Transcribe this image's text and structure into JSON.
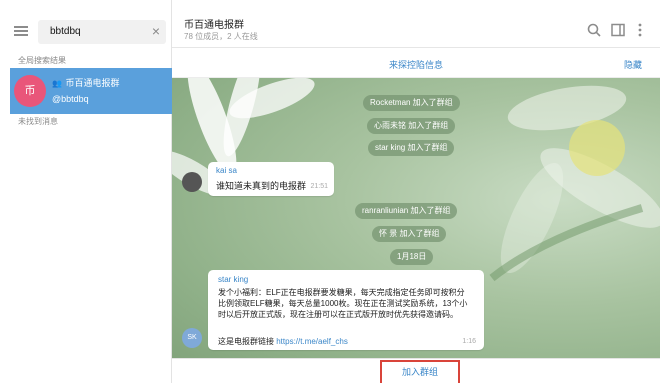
{
  "search": {
    "value": "bbtdbq"
  },
  "sidebar": {
    "global_results_label": "全局搜索结果",
    "result": {
      "avatar_text": "币",
      "title": "币百通电报群",
      "username": "@bbtdbq"
    },
    "no_messages_label": "未找到消息"
  },
  "header": {
    "title": "币百通电报群",
    "subtitle": "78 位成员，2 人在线"
  },
  "pinned": {
    "text": "来探控陷信息",
    "hide_label": "隐藏"
  },
  "events": {
    "e1": "Rocketman 加入了群组",
    "e2": "心雨未铭 加入了群组",
    "e3": "star king 加入了群组",
    "e4": "ranranliunian 加入了群组",
    "e5": "怀 景 加入了群组",
    "date": "1月18日"
  },
  "messages": {
    "m1": {
      "sender": "kai sa",
      "text": "谁知道未真到的电报群",
      "time": "21:51"
    },
    "m2": {
      "sender": "star king",
      "line1": "发个小福利：ELF正在电报群要发糖果，每天完成指定任务即可按积分",
      "line2": "比例领取ELF糖果，每天总量1000枚。现在正在测试奖励系统，13个小",
      "line3": "时以后开放正式版，现在注册可以在正式版开放时优先获得邀请码。",
      "line4": "",
      "link_prefix": "这是电报群链接 ",
      "link": "https://t.me/aelf_chs",
      "time": "1:16",
      "avatar_text": "SK"
    }
  },
  "join": {
    "label": "加入群组"
  },
  "colors": {
    "accent": "#3a86c8",
    "selection": "#5aa0dc",
    "highlight_box": "#d9443a"
  }
}
